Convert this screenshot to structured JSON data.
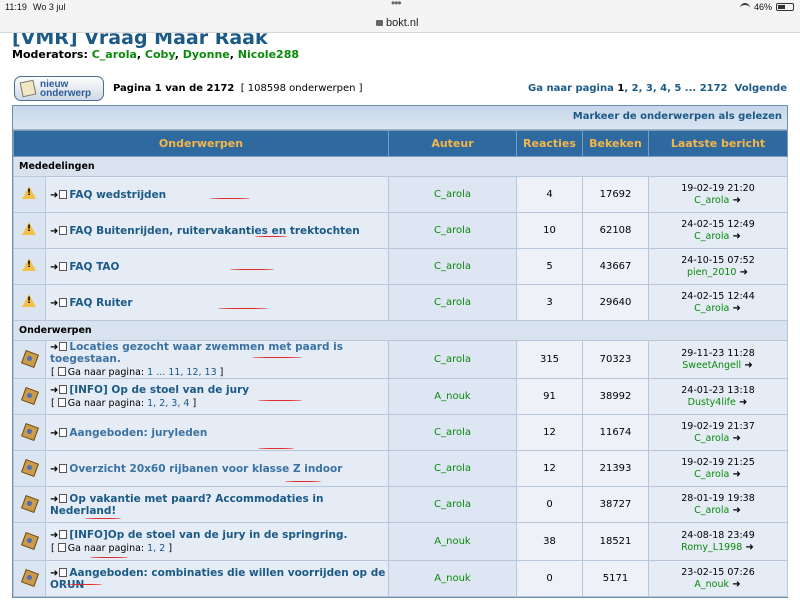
{
  "status": {
    "time": "11:19",
    "date": "Wo 3 jul",
    "battery": "46%"
  },
  "browser": {
    "url": "bokt.nl"
  },
  "forum": {
    "title": "[VMR] Vraag Maar Raak",
    "moderators_label": "Moderators:",
    "moderators": [
      "C_arola",
      "Coby",
      "Dyonne",
      "Nicole288"
    ],
    "new_topic_label_1": "nieuw",
    "new_topic_label_2": "onderwerp",
    "page_label": "Pagina",
    "page_current": "1",
    "page_of": "van de",
    "page_total": "2172",
    "topic_count": "[ 108598 onderwerpen ]",
    "goto_label": "Ga naar pagina",
    "goto_pages": [
      "1",
      "2",
      "3",
      "4",
      "5",
      "...",
      "2172"
    ],
    "next_label": "Volgende",
    "mark_read": "Markeer de onderwerpen als gelezen"
  },
  "table": {
    "headers": [
      "Onderwerpen",
      "Auteur",
      "Reacties",
      "Bekeken",
      "Laatste bericht"
    ],
    "announce_cat": "Mededelingen",
    "topic_cat": "Onderwerpen",
    "announcements": [
      {
        "title": "FAQ wedstrijden",
        "author": "C_arola",
        "replies": "4",
        "views": "17692",
        "last_date": "19-02-19 21:20",
        "last_user": "C_arola"
      },
      {
        "title": "FAQ Buitenrijden, ruitervakanties en trektochten",
        "author": "C_arola",
        "replies": "10",
        "views": "62108",
        "last_date": "24-02-15 12:49",
        "last_user": "C_arola"
      },
      {
        "title": "FAQ TAO",
        "author": "C_arola",
        "replies": "5",
        "views": "43667",
        "last_date": "24-10-15 07:52",
        "last_user": "pien_2010"
      },
      {
        "title": "FAQ Ruiter",
        "author": "C_arola",
        "replies": "3",
        "views": "29640",
        "last_date": "24-02-15 12:44",
        "last_user": "C_arola"
      }
    ],
    "topics": [
      {
        "title": "Locaties gezocht waar zwemmen met paard is toegestaan.",
        "plain": true,
        "author": "C_arola",
        "replies": "315",
        "views": "70323",
        "last_date": "29-11-23 11:28",
        "last_user": "SweetAngell",
        "pages_label": "[",
        "pages_goto": "Ga naar pagina:",
        "pages": "1 ... 11, 12, 13",
        "pages_end": "]"
      },
      {
        "title": "[INFO] Op de stoel van de jury",
        "plain": false,
        "author": "A_nouk",
        "replies": "91",
        "views": "38992",
        "last_date": "24-01-23 13:18",
        "last_user": "Dusty4life",
        "pages_label": "[",
        "pages_goto": "Ga naar pagina:",
        "pages": "1, 2, 3, 4",
        "pages_end": "]"
      },
      {
        "title": "Aangeboden: juryleden",
        "plain": true,
        "author": "C_arola",
        "replies": "12",
        "views": "11674",
        "last_date": "19-02-19 21:37",
        "last_user": "C_arola"
      },
      {
        "title": "Overzicht 20x60 rijbanen voor klasse Z indoor",
        "plain": true,
        "author": "C_arola",
        "replies": "12",
        "views": "21393",
        "last_date": "19-02-19 21:25",
        "last_user": "C_arola"
      },
      {
        "title": "Op vakantie met paard? Accommodaties in Nederland!",
        "plain": false,
        "author": "C_arola",
        "replies": "0",
        "views": "38727",
        "last_date": "28-01-19 19:38",
        "last_user": "C_arola"
      },
      {
        "title": "[INFO]Op de stoel van de jury in de springring.",
        "plain": false,
        "author": "A_nouk",
        "replies": "38",
        "views": "18521",
        "last_date": "24-08-18 23:49",
        "last_user": "Romy_L1998",
        "pages_label": "[",
        "pages_goto": "Ga naar pagina:",
        "pages": "1, 2",
        "pages_end": "]"
      },
      {
        "title": "Aangeboden: combinaties die willen voorrijden op de ORUN",
        "plain": false,
        "author": "A_nouk",
        "replies": "0",
        "views": "5171",
        "last_date": "23-02-15 07:26",
        "last_user": "A_nouk"
      }
    ]
  },
  "colors": {
    "header_bg": "#2e6a9f",
    "header_text": "#f4b64a",
    "link": "#1b5a86",
    "user": "#0a8a0a",
    "annotation": "#e02b2b"
  }
}
